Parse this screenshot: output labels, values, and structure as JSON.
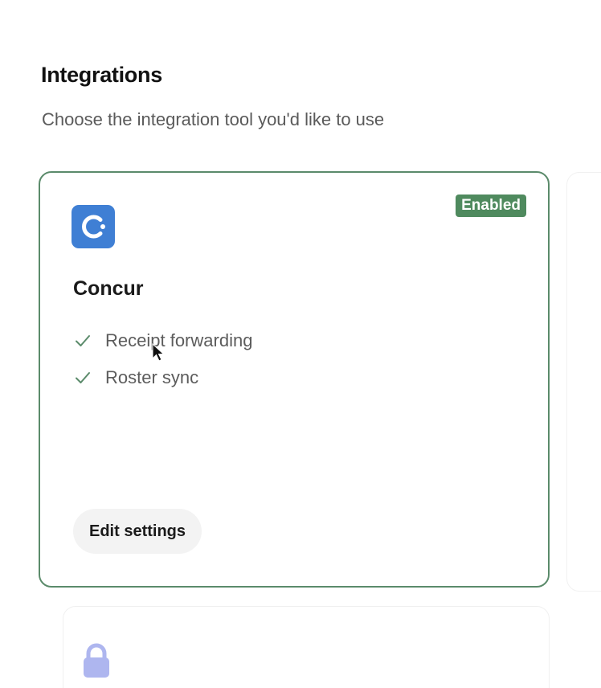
{
  "section": {
    "title": "Integrations",
    "subtitle": "Choose the integration tool you'd like to use"
  },
  "integration": {
    "name": "Concur",
    "status": "Enabled",
    "logo_icon": "concur-logo-icon",
    "features": [
      {
        "label": "Receipt forwarding",
        "icon": "check-icon"
      },
      {
        "label": "Roster sync",
        "icon": "check-icon"
      }
    ],
    "edit_label": "Edit settings"
  },
  "next_integration": {
    "icon": "lock-icon"
  },
  "colors": {
    "accent_green": "#4f8a5e",
    "card_border": "#5b8b6b",
    "concur_blue": "#3f7fd4",
    "lock_purple": "#aeb6ef",
    "check_green": "#5b8b6b"
  }
}
